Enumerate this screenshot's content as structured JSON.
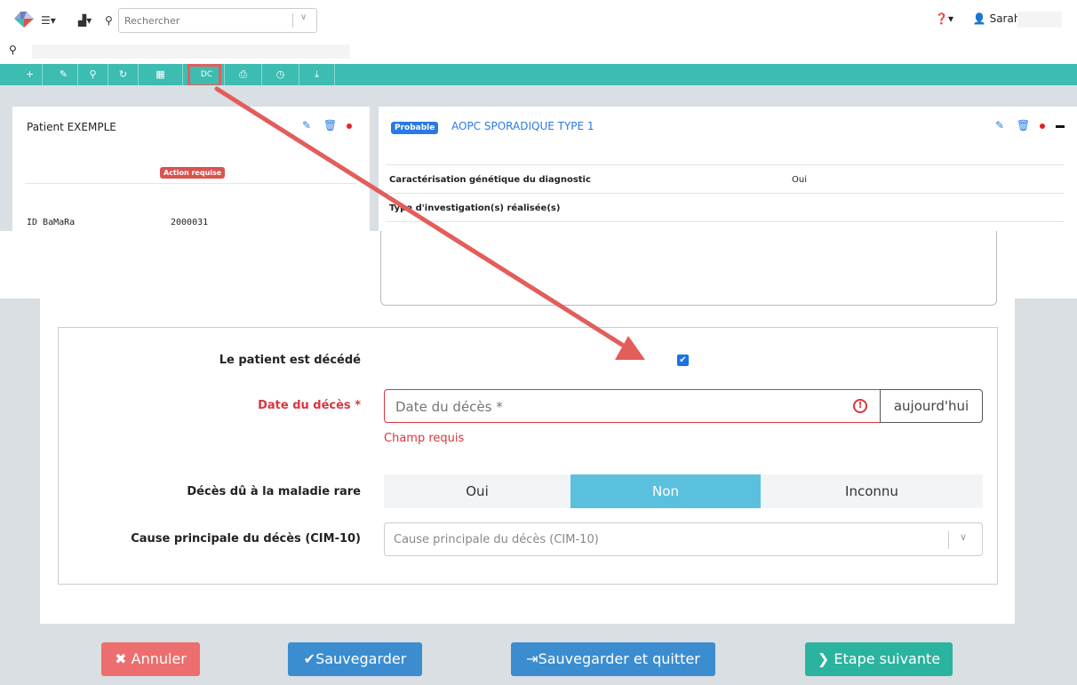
{
  "colors": {
    "toolbar": "#3dbcb1",
    "accent_blue": "#2a7ae2",
    "danger": "#d9353e",
    "selected_segment": "#5bc0de",
    "annotation_arrow": "#e35d5b"
  },
  "header": {
    "search_placeholder": "Rechercher",
    "user_name": "Sarah",
    "icons": [
      "logo",
      "menu-icon",
      "stats-icon",
      "search-icon",
      "help-icon",
      "user-icon",
      "location-icon"
    ]
  },
  "toolbar": {
    "items": [
      {
        "icon": "plus-icon",
        "label": "+"
      },
      {
        "icon": "pencil-icon",
        "label": "✎"
      },
      {
        "icon": "location-icon",
        "label": "⚲"
      },
      {
        "icon": "refresh-icon",
        "label": "↻"
      },
      {
        "icon": "calendar-icon",
        "label": "▦"
      },
      {
        "icon": "dc-button",
        "label": "DC"
      },
      {
        "icon": "print-icon",
        "label": "⎙"
      },
      {
        "icon": "clock-icon",
        "label": "◷"
      },
      {
        "icon": "download-icon",
        "label": "⤓"
      }
    ]
  },
  "patient_card": {
    "name": "Patient EXEMPLE",
    "action_badge": "Action requise",
    "id_label": "ID BaMaRa",
    "id_value": "2000031"
  },
  "diagnosis_card": {
    "badge": "Probable",
    "title": "AOPC SPORADIQUE TYPE 1",
    "rows": [
      {
        "label": "Caractérisation génétique du diagnostic",
        "value": "Oui"
      },
      {
        "label": "Type d'investigation(s) réalisée(s)",
        "value": ""
      }
    ]
  },
  "form": {
    "deceased_label": "Le patient est décédé",
    "deceased_checked": true,
    "death_date_label": "Date du décès *",
    "death_date_placeholder": "Date du décès *",
    "today_button": "aujourd'hui",
    "required_msg": "Champ requis",
    "rare_disease_label": "Décès dû à la maladie rare",
    "rare_disease_options": [
      "Oui",
      "Non",
      "Inconnu"
    ],
    "rare_disease_selected": "Non",
    "cause_label": "Cause principale du décès (CIM-10)",
    "cause_placeholder": "Cause principale du décès (CIM-10)"
  },
  "actions": {
    "cancel": "✖ Annuler",
    "save": "✔Sauvegarder",
    "save_quit": "⇥Sauvegarder et quitter",
    "next": "❯ Etape suivante"
  }
}
